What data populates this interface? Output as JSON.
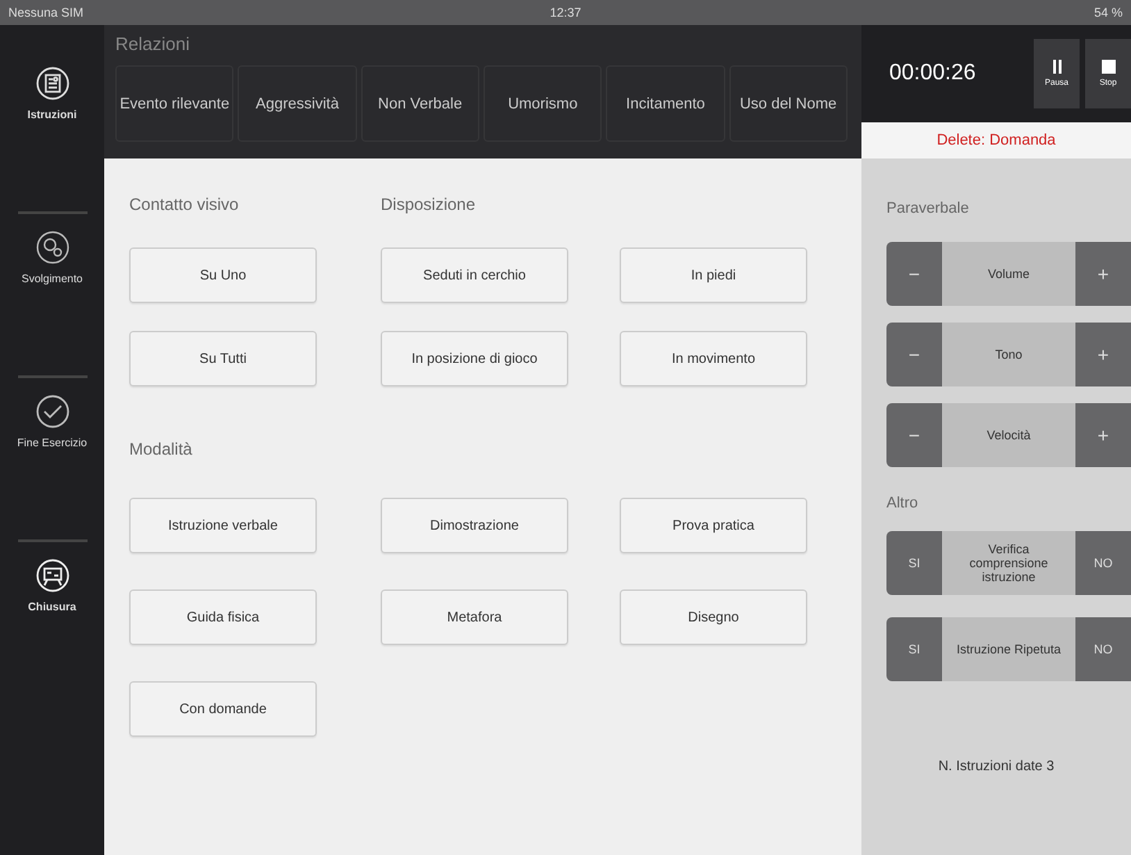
{
  "status_bar": {
    "carrier": "Nessuna SIM",
    "time": "12:37",
    "battery": "54 %"
  },
  "sidebar": {
    "items": [
      {
        "label": "Istruzioni",
        "kind": "document"
      },
      {
        "label": "Svolgimento",
        "kind": "gears"
      },
      {
        "label": "Fine Esercizio",
        "kind": "check"
      },
      {
        "label": "Chiusura",
        "kind": "board"
      }
    ]
  },
  "relazioni": {
    "title": "Relazioni",
    "buttons": [
      "Evento rilevante",
      "Aggressività",
      "Non Verbale",
      "Umorismo",
      "Incitamento",
      "Uso del Nome"
    ]
  },
  "timer": {
    "time": "00:00:26",
    "buttons": [
      {
        "label": "Pausa",
        "kind": "pause"
      },
      {
        "label": "Stop",
        "kind": "stop"
      }
    ]
  },
  "delete_bar": "Delete: Domanda",
  "sections": [
    {
      "title": "Contatto visivo",
      "buttons": [
        "Su Uno",
        "Su Tutti"
      ]
    },
    {
      "title": "Disposizione",
      "buttons": [
        "Seduti in cerchio",
        "In piedi",
        "In posizione di gioco",
        "In movimento"
      ]
    },
    {
      "title": "Modalità",
      "buttons": [
        "Istruzione verbale",
        "Dimostrazione",
        "Prova pratica",
        "Guida fisica",
        "Metafora",
        "Disegno",
        "Con domande"
      ]
    }
  ],
  "paraverbale": {
    "title": "Paraverbale",
    "rows": [
      {
        "minus": "−",
        "label": "Volume",
        "plus": "+"
      },
      {
        "minus": "−",
        "label": "Tono",
        "plus": "+"
      },
      {
        "minus": "−",
        "label": "Velocità",
        "plus": "+"
      }
    ]
  },
  "altro": {
    "title": "Altro",
    "rows": [
      {
        "yes": "SI",
        "label": "Verifica comprensione istruzione",
        "no": "NO"
      },
      {
        "yes": "SI",
        "label": "Istruzione Ripetuta",
        "no": "NO"
      }
    ]
  },
  "footer": "N. Istruzioni date 3"
}
